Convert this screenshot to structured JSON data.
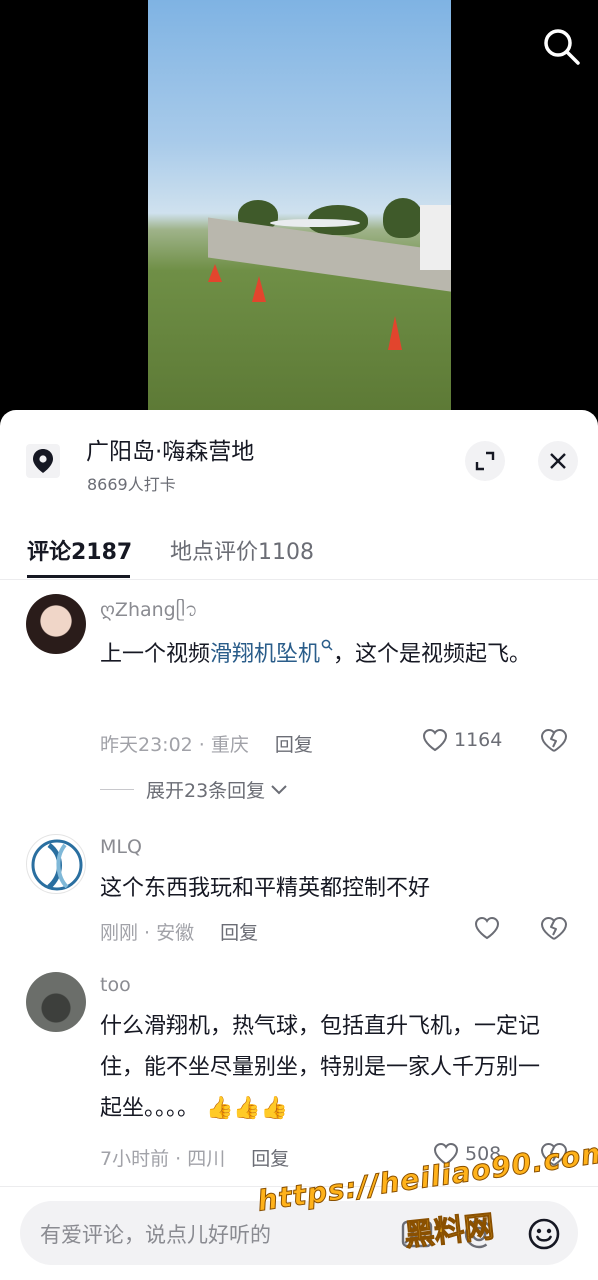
{
  "location": {
    "name": "广阳岛·嗨森营地",
    "checkins": "8669人打卡"
  },
  "tabs": [
    {
      "label": "评论2187"
    },
    {
      "label": "地点评价1108"
    }
  ],
  "comments": [
    {
      "user": "ღZhangᥫ᭡",
      "text_before": "上一个视频",
      "keyword": "滑翔机坠机",
      "text_after": "，这个是视频起飞。",
      "meta": "昨天23:02 · 重庆",
      "reply": "回复",
      "likes": "1164",
      "expand": "展开23条回复"
    },
    {
      "user": "MLQ",
      "text": "这个东西我玩和平精英都控制不好",
      "meta": "刚刚 · 安徽",
      "reply": "回复",
      "likes": ""
    },
    {
      "user": "too",
      "text": "什么滑翔机，热气球，包括直升飞机，一定记住，能不坐尽量别坐，特别是一家人千万别一起坐。。。。",
      "emoji": "👍👍👍",
      "meta": "7小时前 · 四川",
      "reply": "回复",
      "likes": "508"
    }
  ],
  "input": {
    "placeholder": "有爱评论，说点儿好听的"
  },
  "watermark": {
    "url": "https://heiliao90.com",
    "brand": "黑料网"
  },
  "colors": {
    "keyword": "#2a5d8a",
    "text": "#161823",
    "secondary": "#8a8b91"
  }
}
